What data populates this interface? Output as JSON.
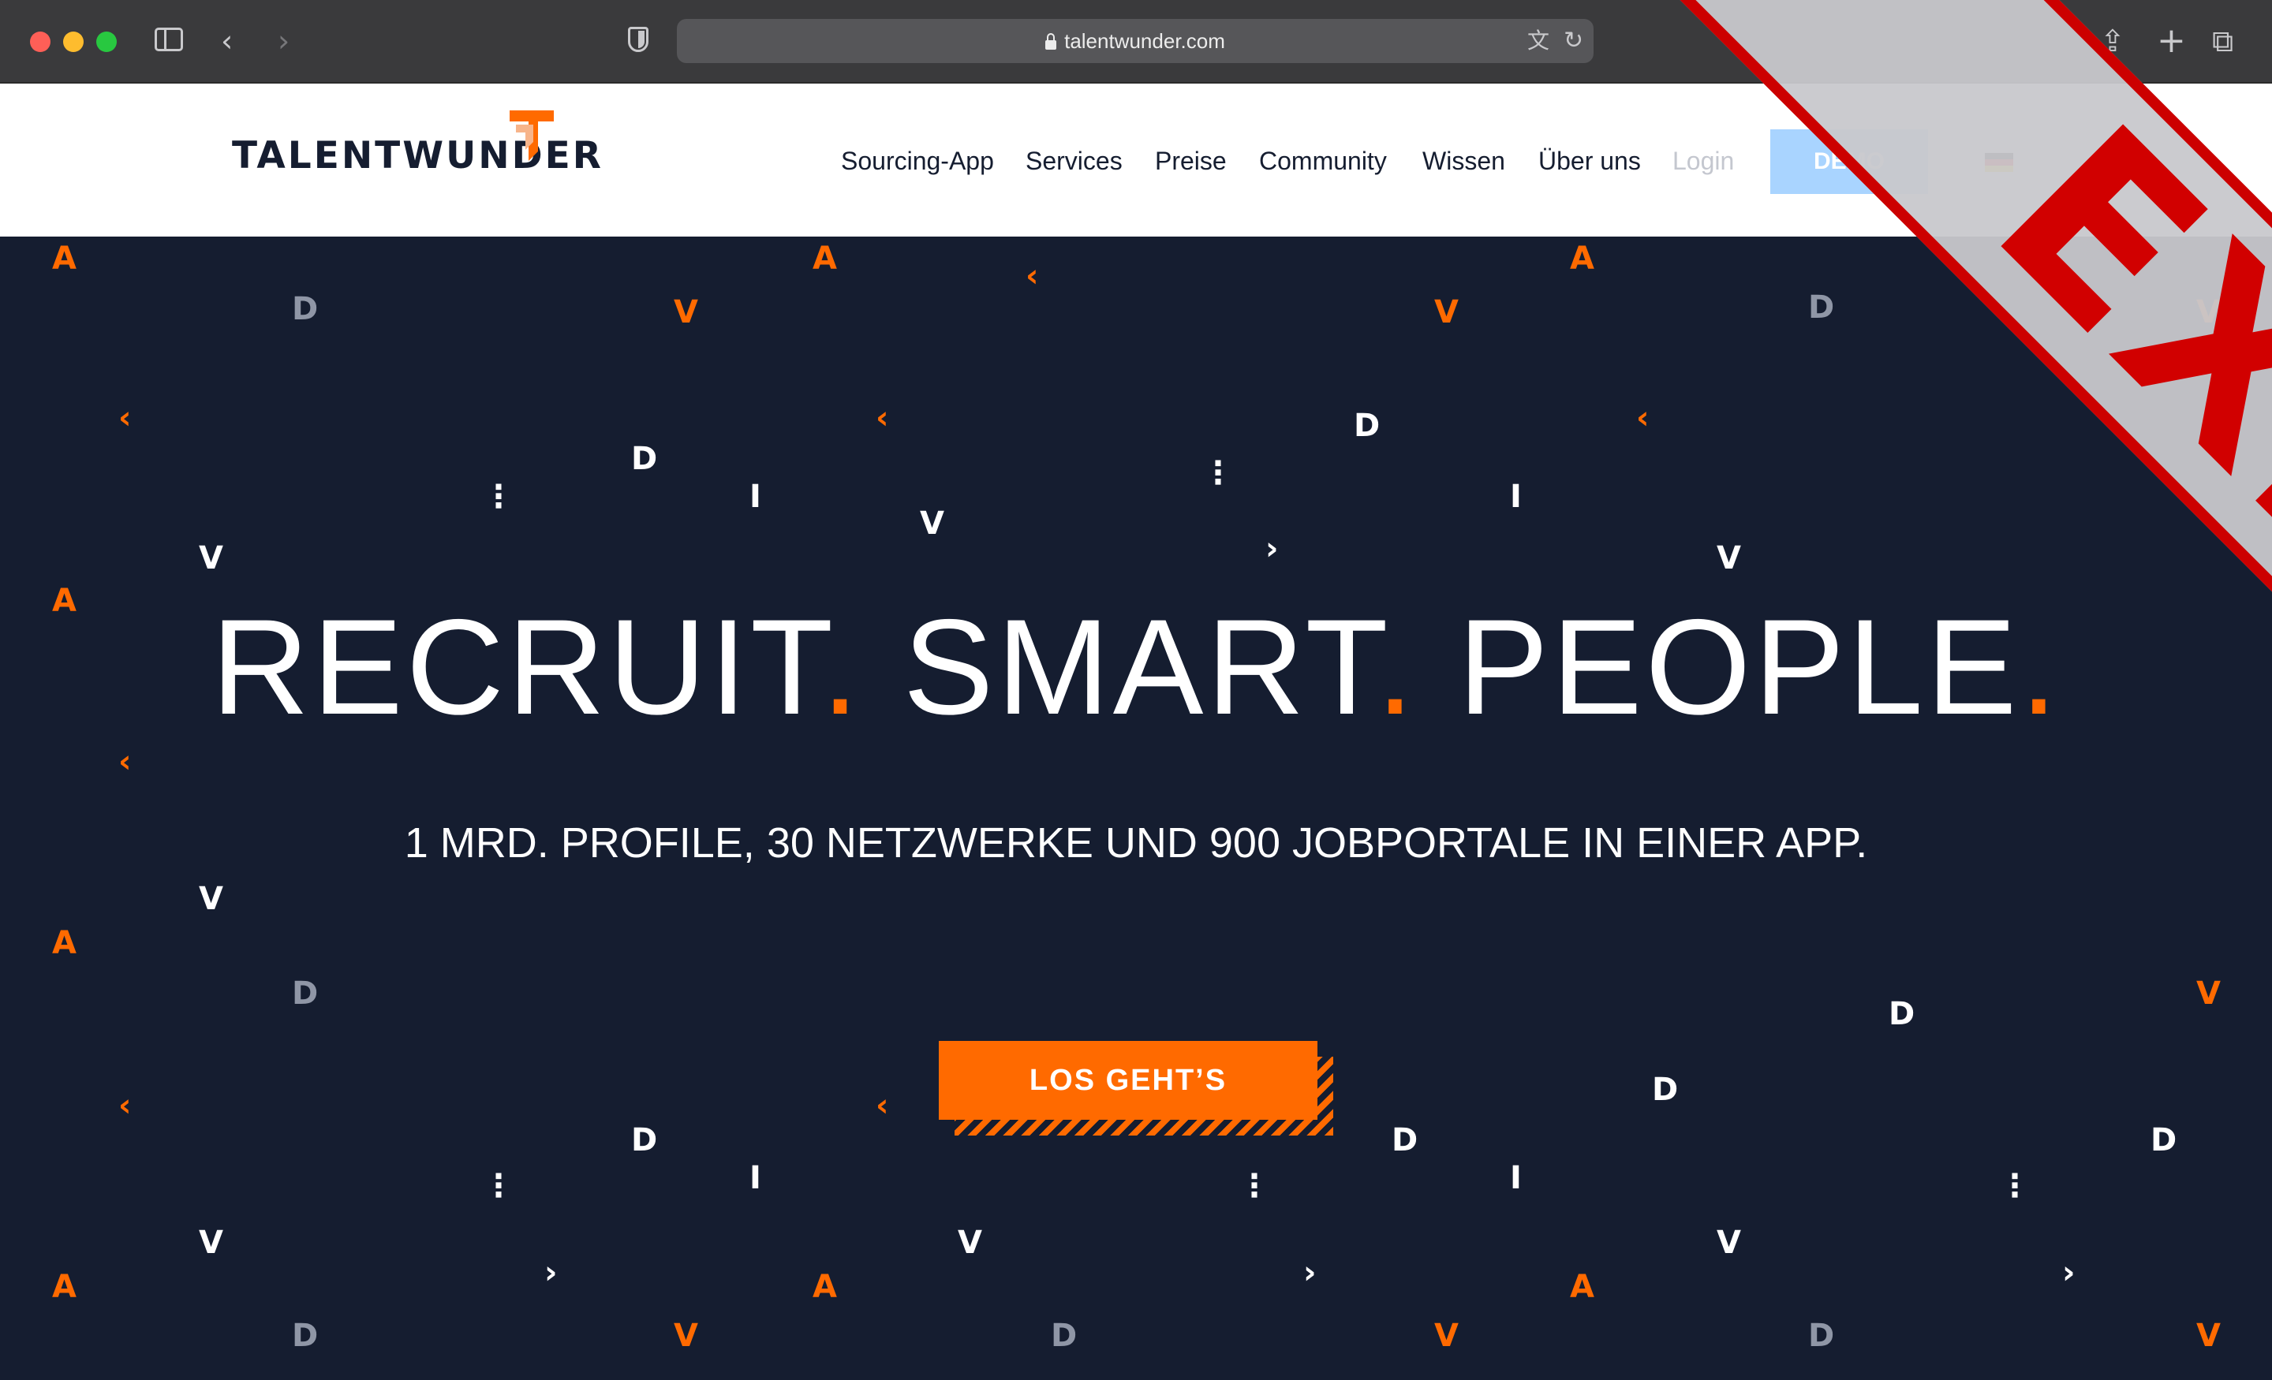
{
  "browser": {
    "url": "talentwunder.com",
    "icons": [
      "sidebar-icon",
      "back-icon",
      "forward-icon",
      "shield-icon",
      "lock-icon",
      "translate-icon",
      "reload-icon",
      "share-icon",
      "new-tab-icon",
      "tabs-overview-icon"
    ]
  },
  "header": {
    "logo": "TALENTWUNDER",
    "nav": {
      "sourcing": "Sourcing-App",
      "services": "Services",
      "preise": "Preise",
      "community": "Community",
      "wissen": "Wissen",
      "ueber_uns": "Über uns",
      "login": "Login"
    },
    "demo_button": "DEMO",
    "language_flag": "de-flag"
  },
  "hero": {
    "headline_parts": [
      "RECRUIT",
      ".",
      "SMART",
      ".",
      "PEOPLE",
      "."
    ],
    "subline": "1 MRD. PROFILE, 30 NETZWERKE UND 900 JOBPORTALE IN EINER APP.",
    "cta": "LOS GEHT’S"
  },
  "overlay": {
    "exit_label": "EXIT"
  },
  "colors": {
    "navy": "#151d30",
    "orange": "#ff6a00",
    "exit_red": "#d10000",
    "demo_blue": "#a9d4ff"
  }
}
